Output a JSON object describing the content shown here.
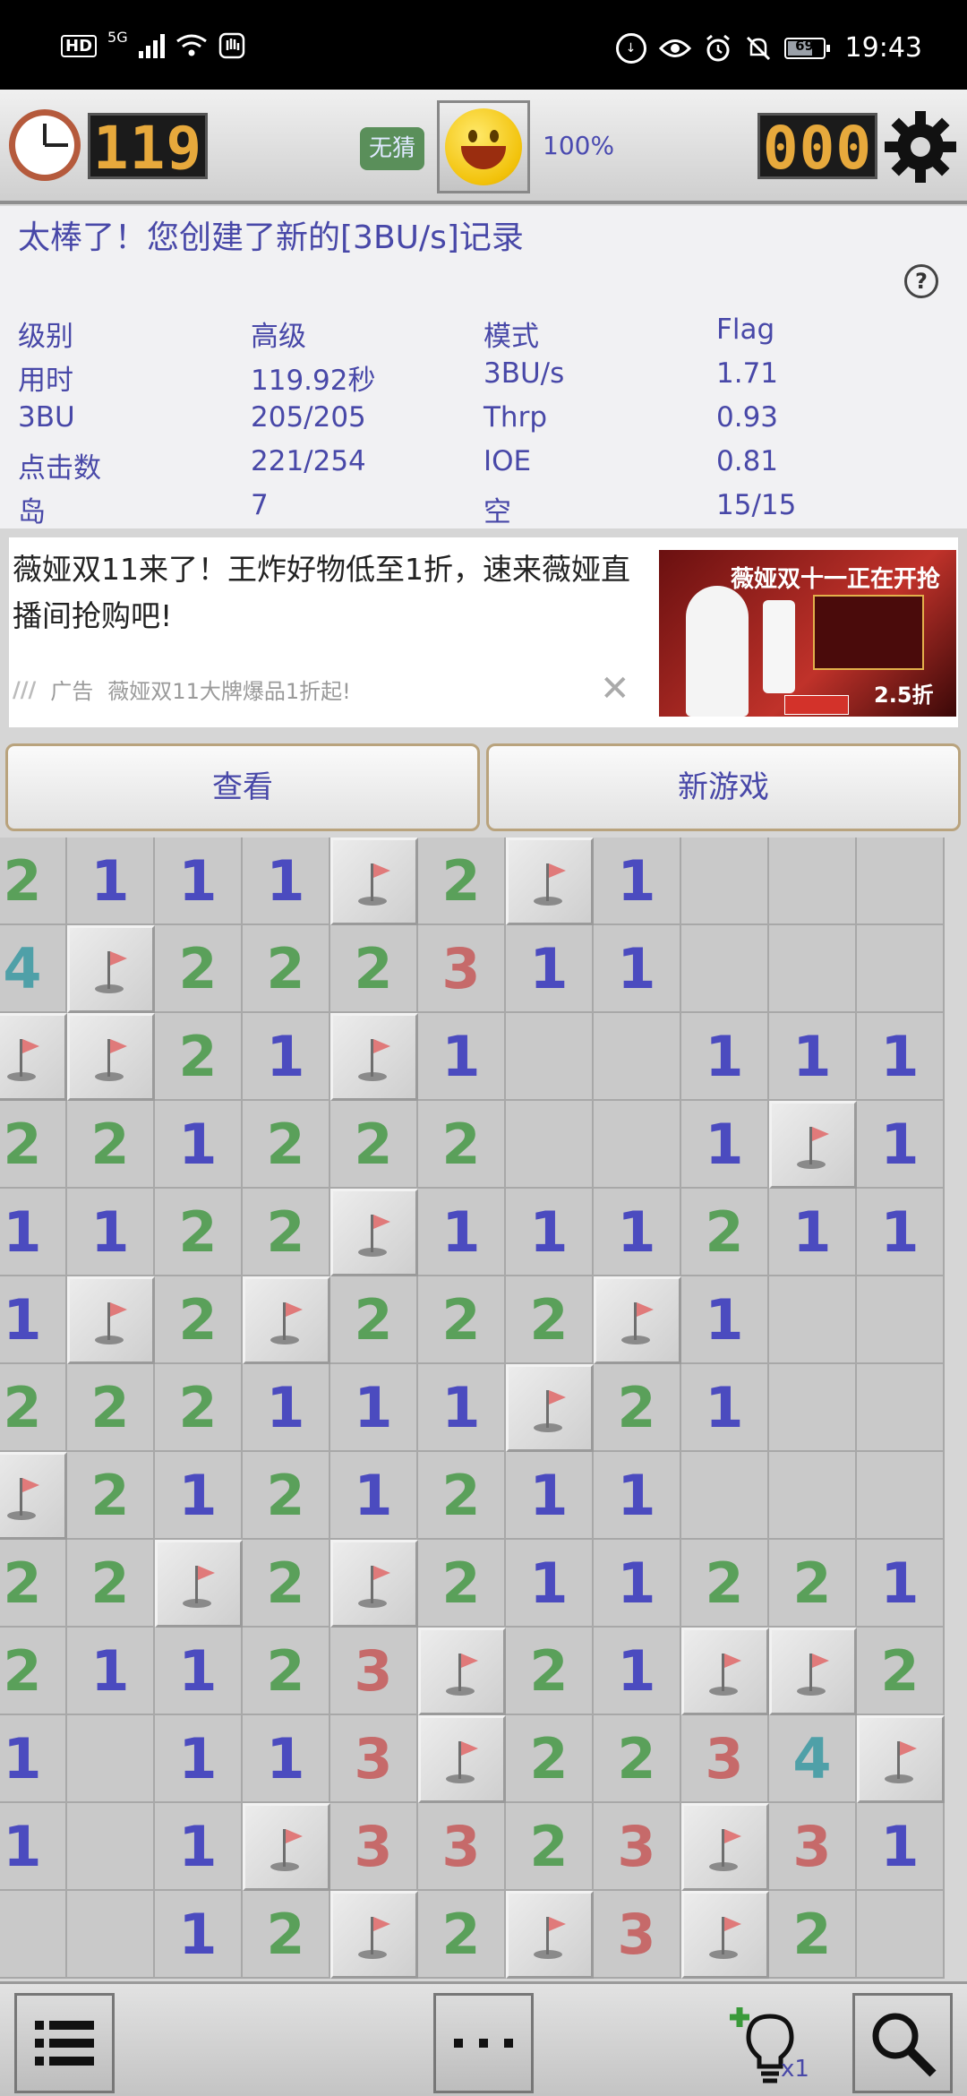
{
  "status_bar": {
    "time": "19:43",
    "network": "5G",
    "hd_label": "HD",
    "battery": "69"
  },
  "game_header": {
    "timer": "119",
    "no_guess_label": "无猜",
    "percent": "100%",
    "mines_left": "000"
  },
  "stats": {
    "message": "太棒了！您创建了新的[3BU/s]记录",
    "help_label": "?",
    "rows": [
      [
        "级别",
        "高级",
        "模式",
        "Flag"
      ],
      [
        "用时",
        "119.92秒",
        "3BU/s",
        "1.71"
      ],
      [
        "3BU",
        "205/205",
        "Thrp",
        "0.93"
      ],
      [
        "点击数",
        "221/254",
        "IOE",
        "0.81"
      ],
      [
        "岛",
        "7",
        "空",
        "15/15"
      ]
    ]
  },
  "ad": {
    "text": "薇娅双11来了！王炸好物低至1折，速来薇娅直播间抢购吧!",
    "tag": "广告",
    "subtitle": "薇娅双11大牌爆品1折起!",
    "close": "✕",
    "image_title": "薇娅双十一正在开抢",
    "image_price": "2.5折"
  },
  "buttons": {
    "view": "查看",
    "new_game": "新游戏"
  },
  "board": [
    [
      "2",
      "1",
      "1",
      "1",
      "F",
      "2",
      "F",
      "1",
      "",
      "",
      ""
    ],
    [
      "4",
      "F",
      "2",
      "2",
      "2",
      "3",
      "1",
      "1",
      "",
      "",
      ""
    ],
    [
      "F",
      "F",
      "2",
      "1",
      "F",
      "1",
      "",
      "",
      "1",
      "1",
      "1"
    ],
    [
      "2",
      "2",
      "1",
      "2",
      "2",
      "2",
      "",
      "",
      "1",
      "F",
      "1"
    ],
    [
      "1",
      "1",
      "2",
      "2",
      "F",
      "1",
      "1",
      "1",
      "2",
      "1",
      "1"
    ],
    [
      "1",
      "F",
      "2",
      "F",
      "2",
      "2",
      "2",
      "F",
      "1",
      "",
      ""
    ],
    [
      "2",
      "2",
      "2",
      "1",
      "1",
      "1",
      "F",
      "2",
      "1",
      "",
      ""
    ],
    [
      "F",
      "2",
      "1",
      "2",
      "1",
      "2",
      "1",
      "1",
      "",
      "",
      ""
    ],
    [
      "2",
      "2",
      "F",
      "2",
      "F",
      "2",
      "1",
      "1",
      "2",
      "2",
      "1"
    ],
    [
      "2",
      "1",
      "1",
      "2",
      "3",
      "F",
      "2",
      "1",
      "F",
      "F",
      "2"
    ],
    [
      "1",
      "",
      "1",
      "1",
      "3",
      "F",
      "2",
      "2",
      "3",
      "4",
      "F"
    ],
    [
      "1",
      "",
      "1",
      "F",
      "3",
      "3",
      "2",
      "3",
      "F",
      "3",
      "1"
    ],
    [
      "",
      "",
      "1",
      "2",
      "F",
      "2",
      "F",
      "3",
      "F",
      "2",
      ""
    ]
  ],
  "footer": {
    "hint_count": "x1"
  },
  "colors": {
    "accent_text": "#4848a8",
    "counter_digits": "#e7a93c",
    "num1": "#4b4bbf",
    "num2": "#5aa05a",
    "num3": "#c66a6a",
    "num4": "#4fa0a8"
  }
}
